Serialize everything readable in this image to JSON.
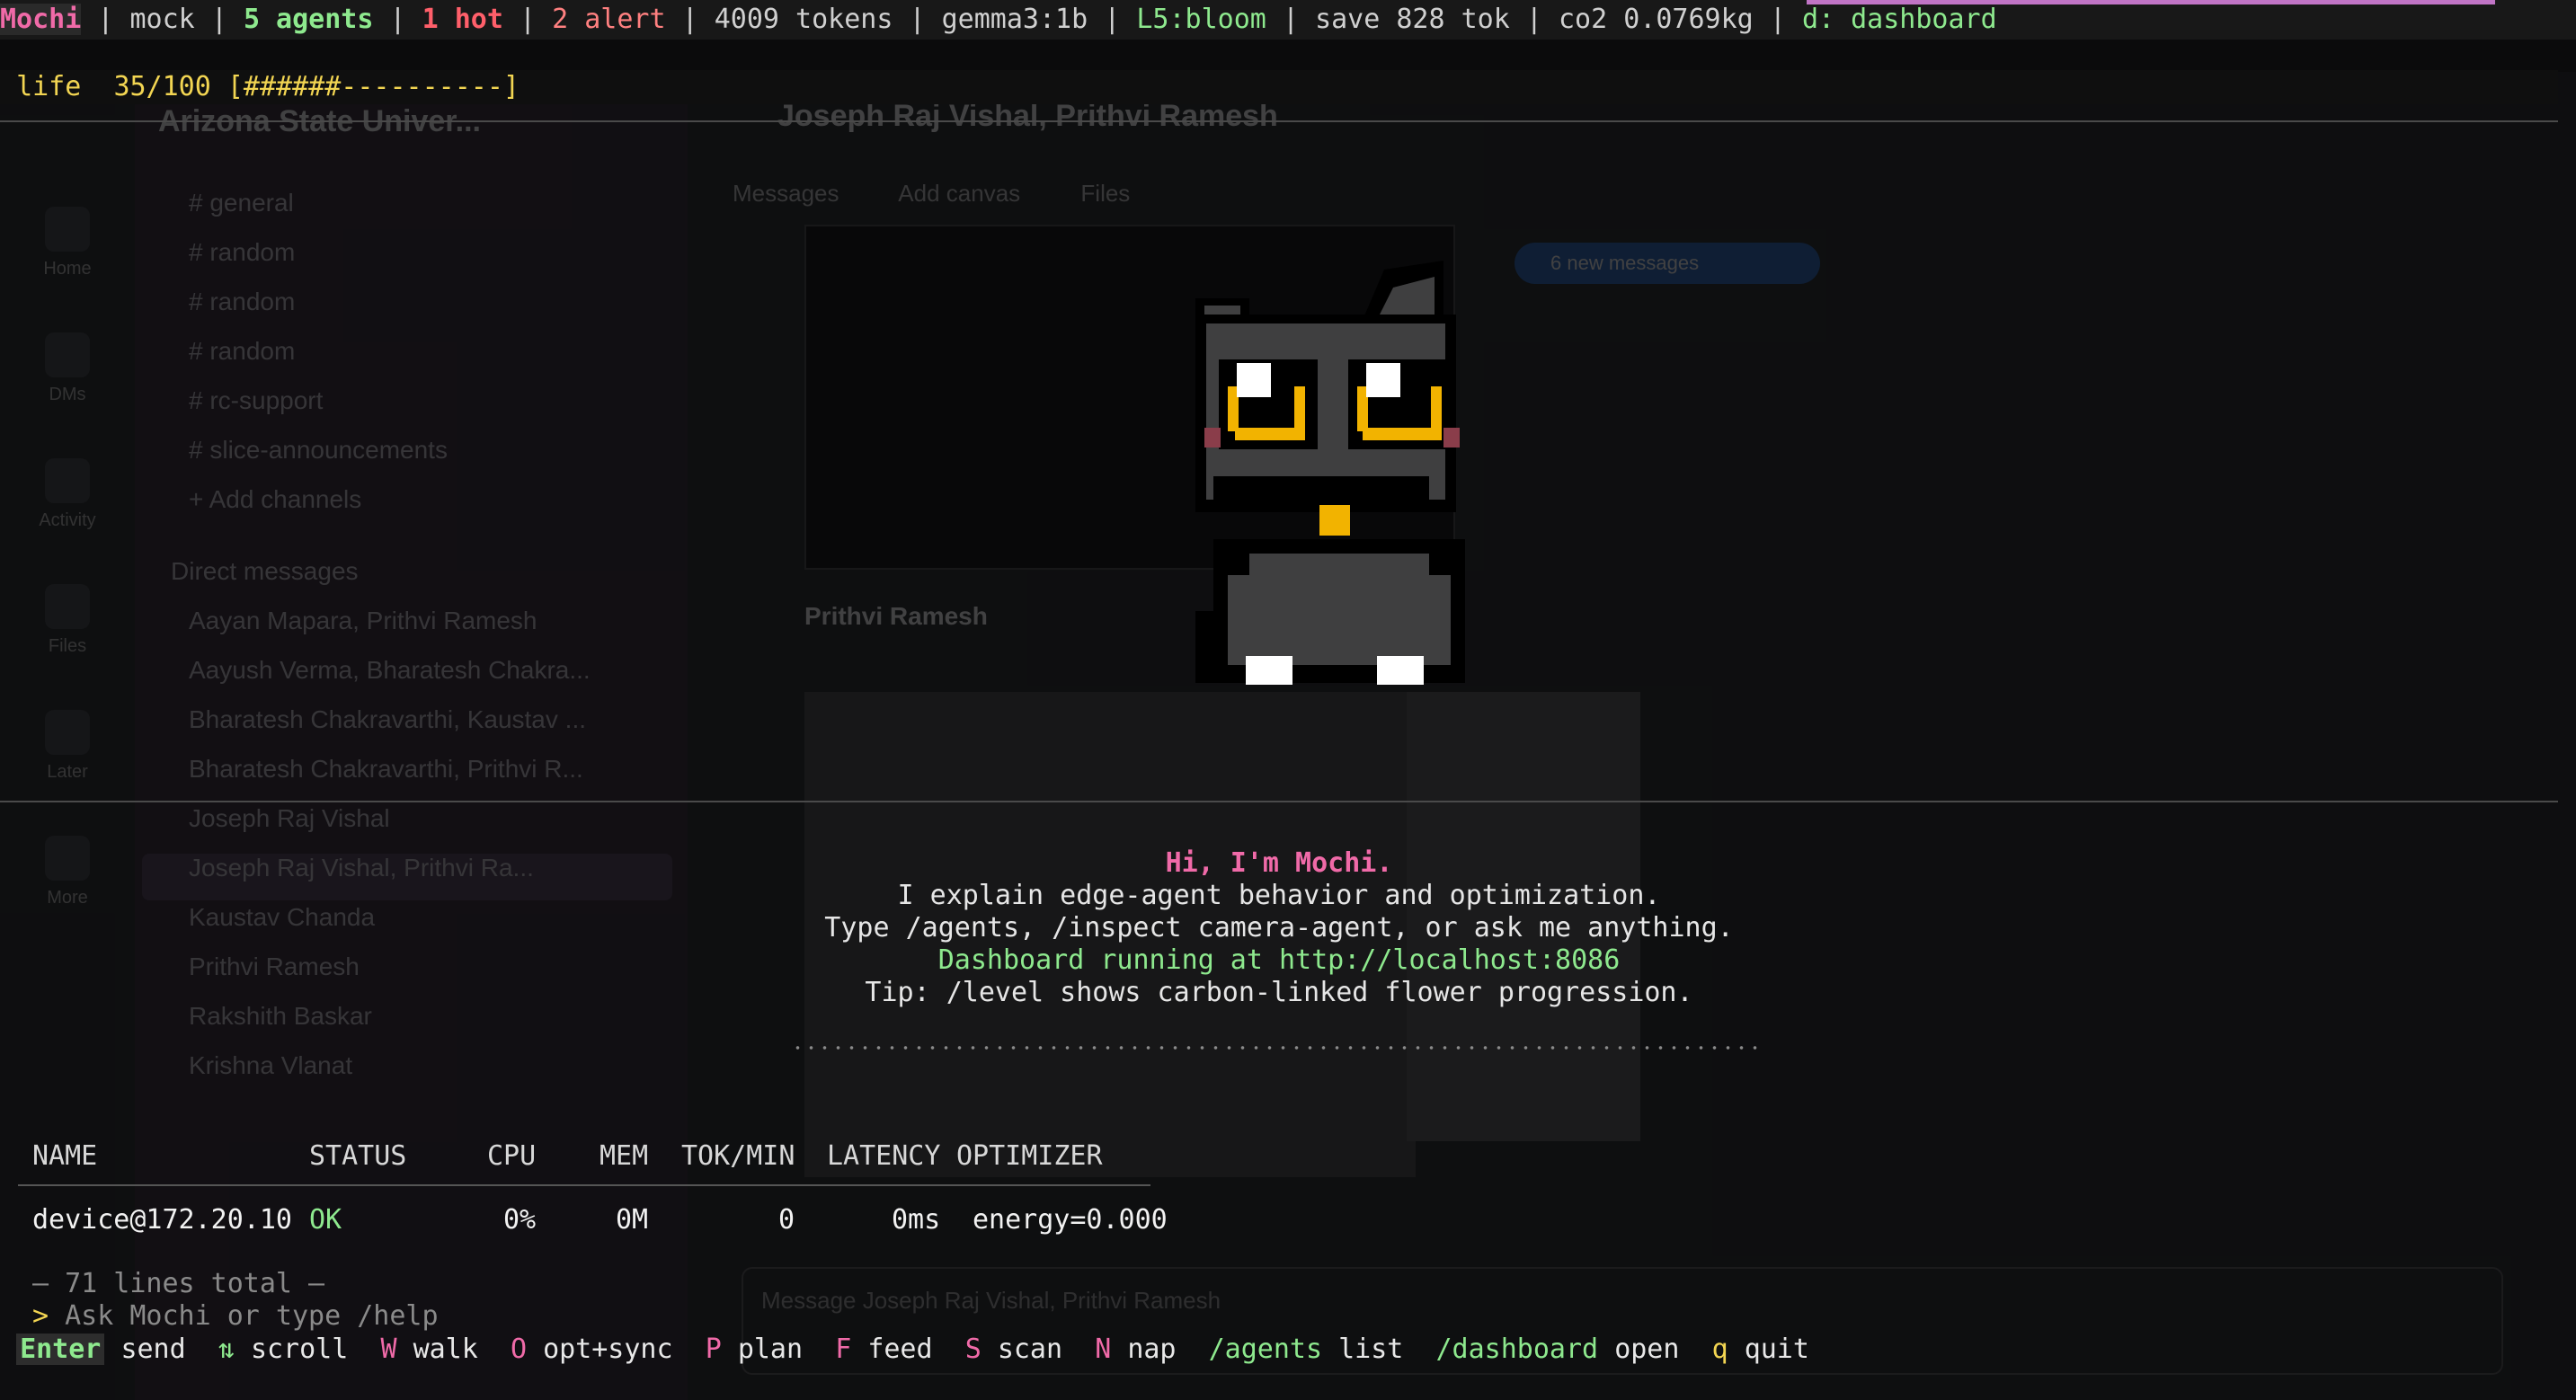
{
  "status_bar": {
    "app": "Mochi",
    "mode": "mock",
    "agents": "5 agents",
    "hot": "1 hot",
    "alert": "2 alert",
    "tokens": "4009 tokens",
    "model": "gemma3:1b",
    "level": "L5:bloom",
    "save": "save 828 tok",
    "co2": "co2 0.0769kg",
    "dashboard_hint": "d: dashboard",
    "separator": "|"
  },
  "life": {
    "label": "life",
    "value": "35/100",
    "bar": "[######----------]",
    "fraction": 0.35
  },
  "welcome": {
    "greeting": "Hi, I'm Mochi.",
    "line1": "I explain edge-agent behavior and optimization.",
    "line2": "Type /agents, /inspect camera-agent, or ask me anything.",
    "line3": "Dashboard running at http://localhost:8086",
    "line4": "Tip: /level shows carbon-linked flower progression."
  },
  "table": {
    "headers": [
      "NAME",
      "STATUS",
      "CPU",
      "MEM",
      "TOK/MIN",
      "LATENCY",
      "OPTIMIZER"
    ],
    "rows": [
      [
        "device@172.20.10",
        "OK",
        "0%",
        "0M",
        "0",
        "0ms",
        "energy=0.000"
      ]
    ]
  },
  "info_line": "— 71 lines total —",
  "prompt": {
    "caret": ">",
    "placeholder": "Ask Mochi or type /help"
  },
  "keybar": [
    {
      "key": "Enter",
      "label": "send"
    },
    {
      "key": "⇅",
      "label": "scroll"
    },
    {
      "key": "W",
      "label": "walk"
    },
    {
      "key": "O",
      "label": "opt+sync"
    },
    {
      "key": "P",
      "label": "plan"
    },
    {
      "key": "F",
      "label": "feed"
    },
    {
      "key": "S",
      "label": "scan"
    },
    {
      "key": "N",
      "label": "nap"
    },
    {
      "key": "/agents",
      "label": "list"
    },
    {
      "key": "/dashboard",
      "label": "open"
    },
    {
      "key": "q",
      "label": "quit"
    }
  ],
  "colors": {
    "pink": "#f06aa8",
    "green": "#8ee98e",
    "yellow": "#f2d552",
    "red": "#ff5f6a",
    "purple": "#c074c5",
    "cat_body": "#3f3f40",
    "cat_eye": "#f2b300"
  },
  "background": {
    "workspace": "Arizona State Univer...",
    "channel_title": "Joseph Raj Vishal, Prithvi Ramesh",
    "tabs": [
      "Messages",
      "Add canvas",
      "Files"
    ],
    "rail": [
      "Home",
      "DMs",
      "Activity",
      "Files",
      "Later",
      "More"
    ],
    "channels": [
      "# general",
      "# random",
      "# random",
      "# random",
      "# rc-support",
      "# slice-announcements",
      "+ Add channels"
    ],
    "dm_header": "Direct messages",
    "dms": [
      "Aayan Mapara, Prithvi Ramesh",
      "Aayush Verma, Bharatesh Chakra...",
      "Bharatesh Chakravarthi, Kaustav ...",
      "Bharatesh Chakravarthi, Prithvi R...",
      "Joseph Raj Vishal",
      "Joseph Raj Vishal, Prithvi Ra...",
      "Kaustav Chanda",
      "Prithvi Ramesh",
      "Rakshith Baskar",
      "Krishna Vlanat"
    ],
    "new_messages": "6 new messages",
    "sender": "Prithvi Ramesh",
    "composer": "Message Joseph Raj Vishal, Prithvi Ramesh"
  }
}
